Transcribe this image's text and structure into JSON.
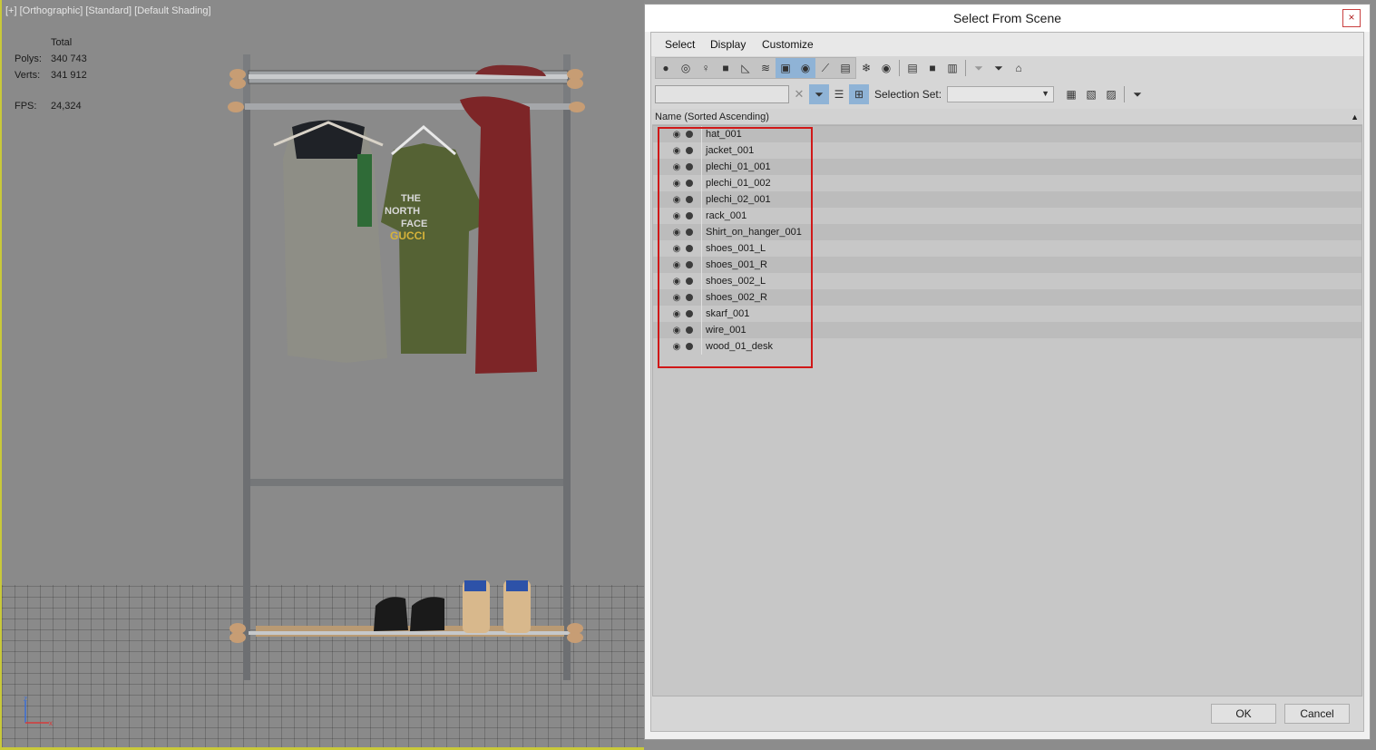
{
  "viewport": {
    "label": "[+] [Orthographic] [Standard] [Default Shading]",
    "stats": {
      "header": "Total",
      "polys_label": "Polys:",
      "polys_value": "340 743",
      "verts_label": "Verts:",
      "verts_value": "341 912",
      "fps_label": "FPS:",
      "fps_value": "24,324"
    },
    "tshirt_print": [
      "THE",
      "NORTH",
      "FACE",
      "GUCCI"
    ]
  },
  "dialog": {
    "title": "Select From Scene",
    "close_glyph": "×",
    "menu": [
      "Select",
      "Display",
      "Customize"
    ],
    "search": {
      "value": "",
      "clear_glyph": "✕"
    },
    "selection_set_label": "Selection Set:",
    "selection_set_value": "",
    "list_header": "Name (Sorted Ascending)",
    "sort_glyph": "▲",
    "items": [
      "hat_001",
      "jacket_001",
      "plechi_01_001",
      "plechi_01_002",
      "plechi_02_001",
      "rack_001",
      "Shirt_on_hanger_001",
      "shoes_001_L",
      "shoes_001_R",
      "shoes_002_L",
      "shoes_002_R",
      "skarf_001",
      "wire_001",
      "wood_01_desk"
    ],
    "ok_label": "OK",
    "cancel_label": "Cancel"
  }
}
